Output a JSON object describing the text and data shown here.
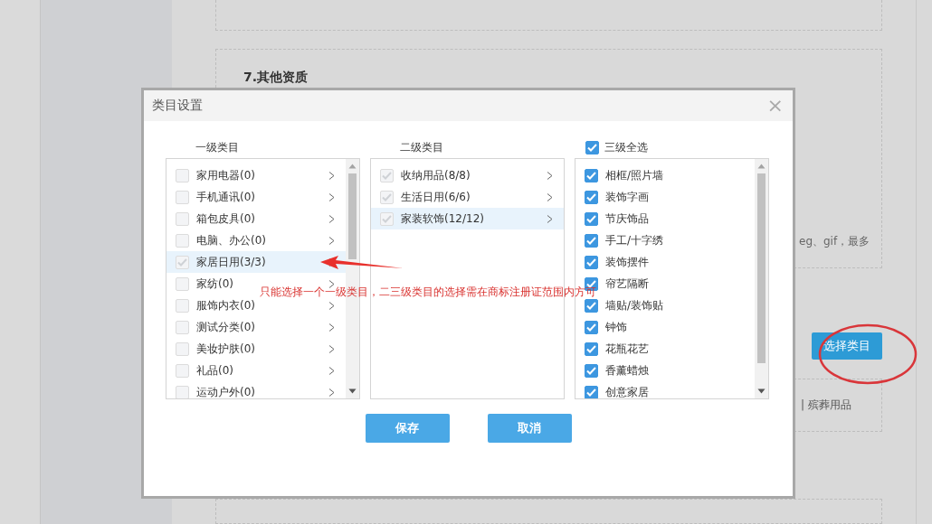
{
  "background": {
    "section_title": "7.其他资质",
    "hint_fragment": "eg、gif，最多",
    "select_button": "选择类目",
    "tag_fragment": "| 殡葬用品"
  },
  "dialog": {
    "title": "类目设置",
    "close": "×",
    "level1": {
      "heading": "一级类目",
      "items": [
        {
          "label": "家用电器(0)",
          "checked": false,
          "selected": false
        },
        {
          "label": "手机通讯(0)",
          "checked": false,
          "selected": false
        },
        {
          "label": "箱包皮具(0)",
          "checked": false,
          "selected": false
        },
        {
          "label": "电脑、办公(0)",
          "checked": false,
          "selected": false
        },
        {
          "label": "家居日用(3/3)",
          "checked": true,
          "selected": true
        },
        {
          "label": "家纺(0)",
          "checked": false,
          "selected": false
        },
        {
          "label": "服饰内衣(0)",
          "checked": false,
          "selected": false
        },
        {
          "label": "测试分类(0)",
          "checked": false,
          "selected": false
        },
        {
          "label": "美妆护肤(0)",
          "checked": false,
          "selected": false
        },
        {
          "label": "礼品(0)",
          "checked": false,
          "selected": false
        },
        {
          "label": "运动户外(0)",
          "checked": false,
          "selected": false
        }
      ]
    },
    "level2": {
      "heading": "二级类目",
      "items": [
        {
          "label": "收纳用品(8/8)",
          "checked": true,
          "selected": false
        },
        {
          "label": "生活日用(6/6)",
          "checked": true,
          "selected": false
        },
        {
          "label": "家装软饰(12/12)",
          "checked": true,
          "selected": true
        }
      ]
    },
    "level3": {
      "select_all": {
        "label": "三级全选",
        "checked": true
      },
      "items": [
        {
          "label": "相框/照片墙",
          "checked": true
        },
        {
          "label": "装饰字画",
          "checked": true
        },
        {
          "label": "节庆饰品",
          "checked": true
        },
        {
          "label": "手工/十字绣",
          "checked": true
        },
        {
          "label": "装饰摆件",
          "checked": true
        },
        {
          "label": "帘艺隔断",
          "checked": true
        },
        {
          "label": "墙贴/装饰贴",
          "checked": true
        },
        {
          "label": "钟饰",
          "checked": true
        },
        {
          "label": "花瓶花艺",
          "checked": true
        },
        {
          "label": "香薰蜡烛",
          "checked": true
        },
        {
          "label": "创意家居",
          "checked": true
        }
      ]
    },
    "buttons": [
      "保存",
      "取消"
    ]
  },
  "annotation": {
    "text": "只能选择一个一级类目，二三级类目的选择需在商标注册证范围内方可"
  }
}
